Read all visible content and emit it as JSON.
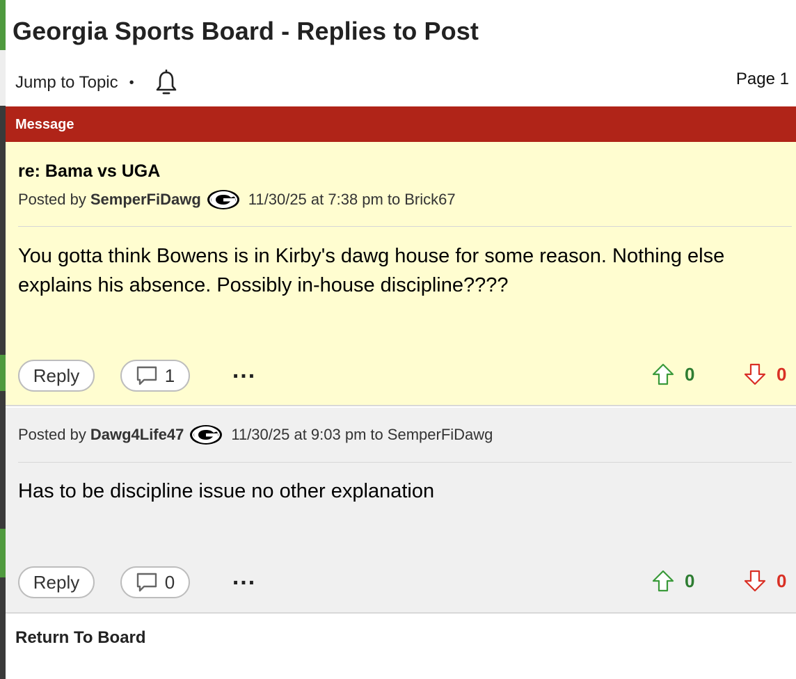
{
  "page": {
    "title": "Georgia Sports Board - Replies to Post",
    "jump_to_topic": "Jump to Topic",
    "separator": "•",
    "page_label": "Page 1",
    "message_header": "Message",
    "return_link": "Return To Board"
  },
  "posts": [
    {
      "title": "re: Bama vs UGA",
      "posted_by_label": "Posted by",
      "author": "SemperFiDawg",
      "timestamp": "11/30/25 at 7:38 pm",
      "to_label": "to",
      "to_user": "Brick67",
      "body": "You gotta think Bowens is in Kirby's dawg house for some reason. Nothing else explains his absence. Possibly in-house discipline????",
      "reply_label": "Reply",
      "comment_count": "1",
      "more_label": "...",
      "upvotes": "0",
      "downvotes": "0"
    },
    {
      "posted_by_label": "Posted by",
      "author": "Dawg4Life47",
      "timestamp": "11/30/25 at 9:03 pm",
      "to_label": "to",
      "to_user": "SemperFiDawg",
      "body": "Has to be discipline issue no other explanation",
      "reply_label": "Reply",
      "comment_count": "0",
      "more_label": "...",
      "upvotes": "0",
      "downvotes": "0"
    }
  ],
  "icons": {
    "bell": "bell-icon",
    "team_logo": "georgia-g-logo",
    "comment": "comment-bubble-icon",
    "upvote": "arrow-up-icon",
    "downvote": "arrow-down-icon",
    "more": "more-dots-icon"
  },
  "colors": {
    "header_red": "#b02418",
    "post_highlight": "#fffdd0",
    "post_normal": "#f0f0f0",
    "upvote_green": "#2e7d32",
    "downvote_red": "#d93025"
  }
}
